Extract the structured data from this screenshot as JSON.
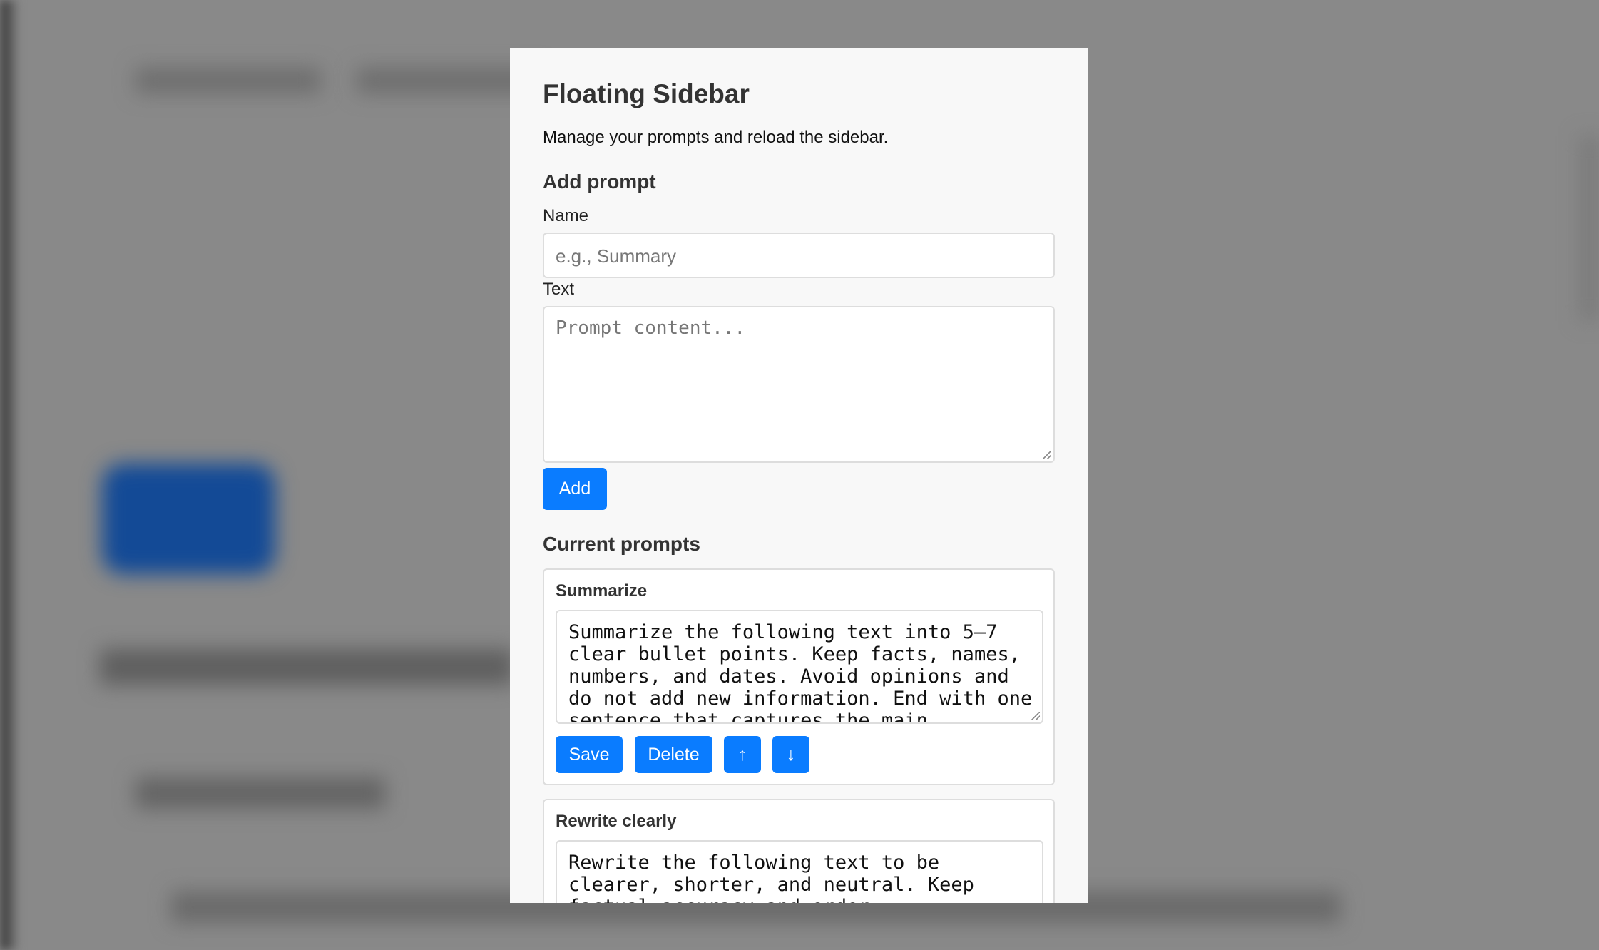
{
  "panel": {
    "title": "Floating Sidebar",
    "subtitle": "Manage your prompts and reload the sidebar.",
    "add_section": {
      "heading": "Add prompt",
      "name_label": "Name",
      "name_placeholder": "e.g., Summary",
      "text_label": "Text",
      "text_placeholder": "Prompt content...",
      "add_button": "Add"
    },
    "current_section": {
      "heading": "Current prompts",
      "prompts": [
        {
          "name": "Summarize",
          "text": "Summarize the following text into 5–7\nclear bullet points. Keep facts, names,\nnumbers, and dates. Avoid opinions and\ndo not add new information. End with one\nsentence that captures the main"
        },
        {
          "name": "Rewrite clearly",
          "text": "Rewrite the following text to be\nclearer, shorter, and neutral. Keep\nfactual accuracy and order."
        }
      ],
      "save_button": "Save",
      "delete_button": "Delete",
      "move_up_button": "↑",
      "move_down_button": "↓"
    }
  },
  "colors": {
    "accent": "#0a7cff",
    "overlay": "#898989",
    "panel_bg": "#f8f8f8"
  }
}
